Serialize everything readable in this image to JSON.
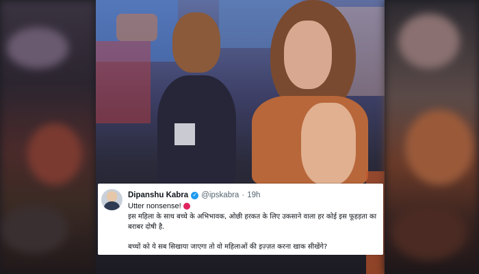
{
  "tweet": {
    "display_name": "Dipanshu Kabra",
    "handle": "@ipskabra",
    "separator": "·",
    "time": "19h",
    "line1": "Utter nonsense!",
    "line2": "इस महिला के साथ बच्चे के अभिभावक, ओछी हरकत के लिए उकसाने वाला हर कोई इस फूहड़ता का बराबर दोषी है.",
    "line3": "बच्चों को ये सब सिखाया जाएगा तो वो महिलाओं की इज़्ज़त करना खाक सीखेंगे?"
  },
  "icons": {
    "verified": "verified-badge-icon",
    "emoji": "angry-face-emoji-icon",
    "avatar": "profile-photo"
  },
  "colors": {
    "verified_blue": "#1d9bf0",
    "text_primary": "#0f1419",
    "text_secondary": "#536471"
  }
}
